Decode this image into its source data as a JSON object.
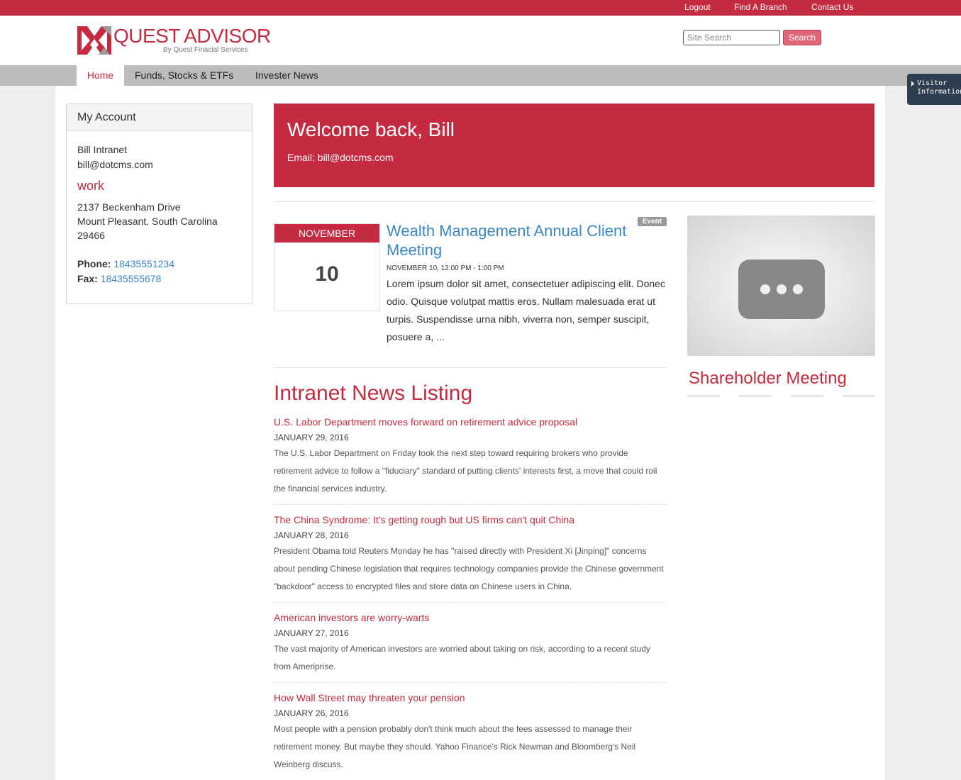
{
  "topbar": {
    "links": [
      "Logout",
      "Find A Branch",
      "Contact Us"
    ]
  },
  "header": {
    "brand": "QUEST ADVISOR",
    "tagline": "By Quest Finacial Services",
    "search_placeholder": "Site Search",
    "search_button": "Search"
  },
  "nav": {
    "items": [
      "Home",
      "Funds, Stocks & ETFs",
      "Invester News"
    ],
    "active": "Home"
  },
  "visitor_tab": {
    "line1": "Visitor",
    "line2": "Information"
  },
  "account": {
    "heading": "My Account",
    "name": "Bill Intranet",
    "email": "bill@dotcms.com",
    "address_type": "work",
    "street": "2137 Beckenham Drive",
    "city_state": "Mount Pleasant, South Carolina",
    "zip": "29466",
    "phone_label": "Phone:",
    "phone": "18435551234",
    "fax_label": "Fax:",
    "fax": "18435555678"
  },
  "welcome": {
    "title": "Welcome back, Bill",
    "email_line": "Email: bill@dotcms.com"
  },
  "event": {
    "month": "NOVEMBER",
    "day": "10",
    "badge": "Event",
    "title": "Wealth Management Annual Client Meeting",
    "time": "NOVEMBER 10, 12:00 PM - 1:00 PM",
    "description": "Lorem ipsum dolor sit amet, consectetuer adipiscing elit. Donec odio. Quisque volutpat mattis eros. Nullam malesuada erat ut turpis. Suspendisse urna nibh, viverra non, semper suscipit, posuere a, ..."
  },
  "news": {
    "heading": "Intranet News Listing",
    "items": [
      {
        "title": "U.S. Labor Department moves forward on retirement advice proposal",
        "date": "JANUARY 29, 2016",
        "summary": "The U.S. Labor Department on Friday took the next step toward requiring brokers who provide retirement advice to follow a \"fiduciary\" standard of putting clients' interests first, a move that could roil the financial services industry."
      },
      {
        "title": "The China Syndrome: It's getting rough but US firms can't quit China",
        "date": "JANUARY 28, 2016",
        "summary": "President Obama told Reuters Monday he has \"raised directly with President Xi [Jinping]\" concerns about pending Chinese legislation that requires technology companies provide the Chinese government \"backdoor\" access to encrypted files and store data on Chinese users in China."
      },
      {
        "title": "American investors are worry-warts",
        "date": "JANUARY 27, 2016",
        "summary": "The vast majority of American investors are worried about taking on risk, according to a recent study from Ameriprise."
      },
      {
        "title": "How Wall Street may threaten your pension",
        "date": "JANUARY 26, 2016",
        "summary": "Most people with a pension probably don't think much about the fees assessed to manage their retirement money. But maybe they should. Yahoo Finance's Rick Newman and Bloomberg's Neil Weinberg discuss."
      }
    ]
  },
  "sidebar_media": {
    "icon": "video-placeholder-icon",
    "title": "Shareholder Meeting"
  },
  "colors": {
    "brand": "#c52b40",
    "link": "#3a87c7",
    "nav_bg": "#bcbcbc"
  }
}
